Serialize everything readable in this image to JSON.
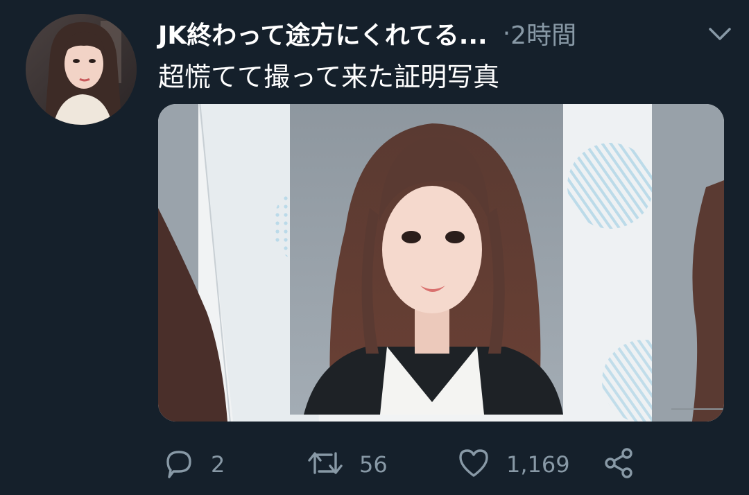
{
  "tweet": {
    "author": "JK終わって途方にくれてる...",
    "separator": "·",
    "time": "2時間",
    "text": "超慌てて撮って来た証明写真",
    "avatar_icon": "profile-photo",
    "caret_icon": "chevron-down-icon",
    "media": {
      "description_icon": "id-photo-image"
    },
    "actions": {
      "reply_count": "2",
      "retweet_count": "56",
      "like_count": "1,169"
    }
  },
  "colors": {
    "background": "#15202b",
    "primary_text": "#ffffff",
    "secondary_text": "#8899a6",
    "icon": "#8899a6"
  }
}
